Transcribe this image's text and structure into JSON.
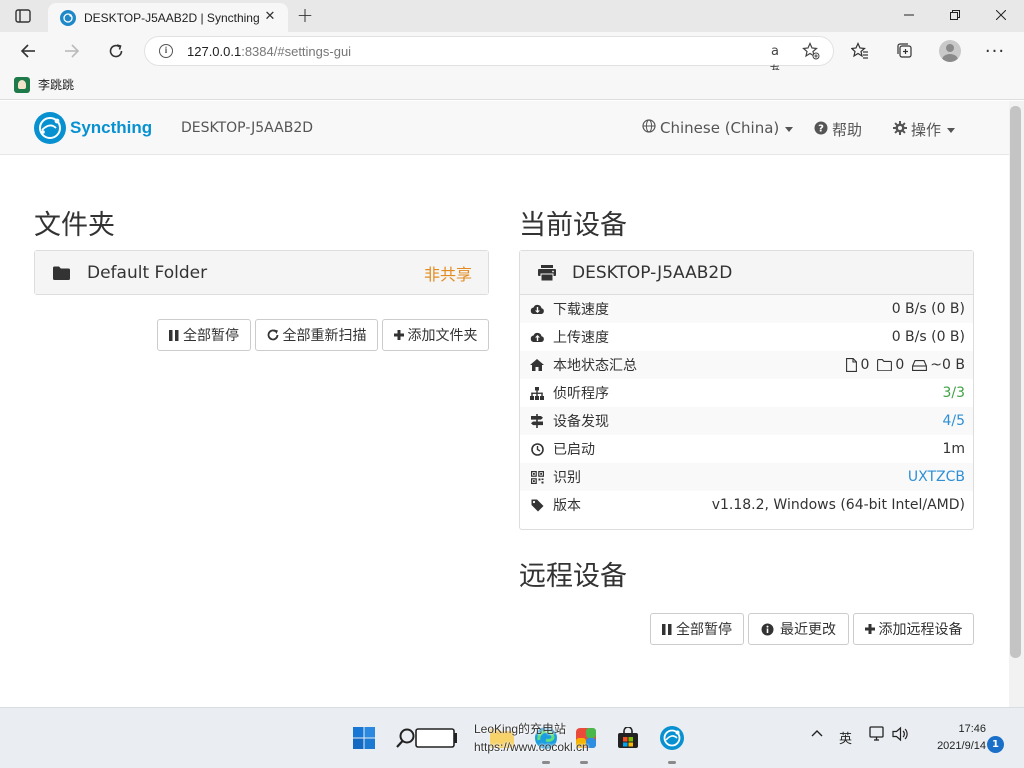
{
  "browser": {
    "tab_title": "DESKTOP-J5AAB2D | Syncthing",
    "tab_close_glyph": "✕",
    "new_tab_glyph": "+",
    "url_host": "127.0.0.1",
    "url_rest": ":8384/#settings-gui",
    "read_aloud_glyph": "aあ",
    "bookmark_label": "李跳跳"
  },
  "navbar": {
    "brand": "Syncthing",
    "device_name": "DESKTOP-J5AAB2D",
    "language": "Chinese (China)",
    "help": "帮助",
    "actions": "操作"
  },
  "folders": {
    "title": "文件夹",
    "items": [
      {
        "name": "Default Folder",
        "status": "非共享"
      }
    ],
    "buttons": {
      "pause_all": "全部暂停",
      "rescan_all": "全部重新扫描",
      "add_folder": "添加文件夹"
    }
  },
  "this_device": {
    "title": "当前设备",
    "name": "DESKTOP-J5AAB2D",
    "rows": [
      {
        "label": "下载速度",
        "value": "0 B/s (0 B)"
      },
      {
        "label": "上传速度",
        "value": "0 B/s (0 B)"
      },
      {
        "label": "本地状态汇总",
        "files": "0",
        "dirs": "0",
        "size": "~0 B"
      },
      {
        "label": "侦听程序",
        "value": "3/3"
      },
      {
        "label": "设备发现",
        "value": "4/5"
      },
      {
        "label": "已启动",
        "value": "1m"
      },
      {
        "label": "识别",
        "value": "UXTZCB"
      },
      {
        "label": "版本",
        "value": "v1.18.2, Windows (64-bit Intel/AMD)"
      }
    ]
  },
  "remote_devices": {
    "title": "远程设备",
    "buttons": {
      "pause_all": "全部暂停",
      "recent_changes": "最近更改",
      "add_remote": "添加远程设备"
    }
  },
  "taskbar": {
    "watermark_line1": "LeoKing的充电站",
    "watermark_line2": "https://www.cocokl.cn",
    "ime": "英",
    "time": "17:46",
    "date": "2021/9/14",
    "notifications": "1"
  },
  "colors": {
    "brand": "#0891d1",
    "warning": "#e38b1f",
    "success": "#3fa344",
    "link": "#2f8fd5"
  }
}
